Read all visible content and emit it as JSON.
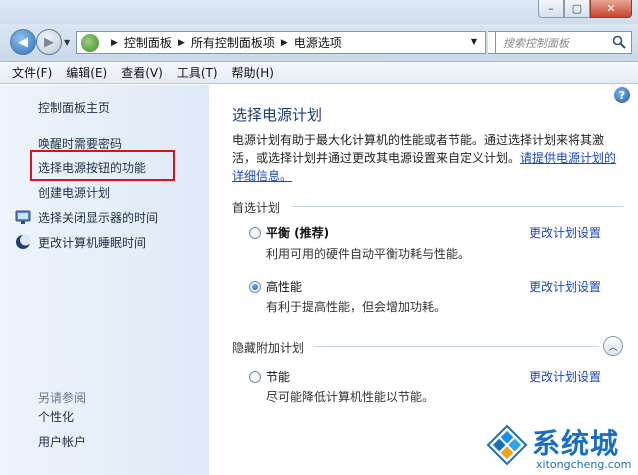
{
  "window": {
    "minimize": "–",
    "maximize": "▢",
    "close": "✕"
  },
  "nav": {
    "back": "◀",
    "forward": "▶",
    "dropdown": "▼",
    "refresh": "↻"
  },
  "address": {
    "crumbs": [
      "控制面板",
      "所有控制面板项",
      "电源选项"
    ]
  },
  "search": {
    "placeholder": "搜索控制面板"
  },
  "menu": [
    "文件(F)",
    "编辑(E)",
    "查看(V)",
    "工具(T)",
    "帮助(H)"
  ],
  "sidebar": {
    "home": "控制面板主页",
    "items": [
      {
        "label": "唤醒时需要密码"
      },
      {
        "label": "选择电源按钮的功能"
      },
      {
        "label": "创建电源计划"
      },
      {
        "label": "选择关闭显示器的时间"
      },
      {
        "label": "更改计算机睡眠时间"
      }
    ],
    "see_also": "另请参阅",
    "see_also_items": [
      {
        "label": "个性化"
      },
      {
        "label": "用户帐户"
      }
    ]
  },
  "main": {
    "title": "选择电源计划",
    "desc_text": "电源计划有助于最大化计算机的性能或者节能。通过选择计划来将其激活，或选择计划并通过更改其电源设置来自定义计划。",
    "desc_link": "请提供电源计划的详细信息。",
    "preferred_header": "首选计划",
    "hidden_header": "隐藏附加计划",
    "plans": [
      {
        "name": "平衡 (推荐)",
        "desc": "利用可用的硬件自动平衡功耗与性能。",
        "link": "更改计划设置",
        "selected": false
      },
      {
        "name": "高性能",
        "desc": "有利于提高性能，但会增加功耗。",
        "link": "更改计划设置",
        "selected": true
      },
      {
        "name": "节能",
        "desc": "尽可能降低计算机性能以节能。",
        "link": "更改计划设置",
        "selected": false
      }
    ],
    "collapse": "︿",
    "help": "?"
  },
  "watermark": {
    "title": "系统城",
    "url": "xitongcheng.com"
  },
  "colors": {
    "highlight_box": "#d8141b",
    "link": "#1a47c2",
    "title": "#1d3b78"
  }
}
